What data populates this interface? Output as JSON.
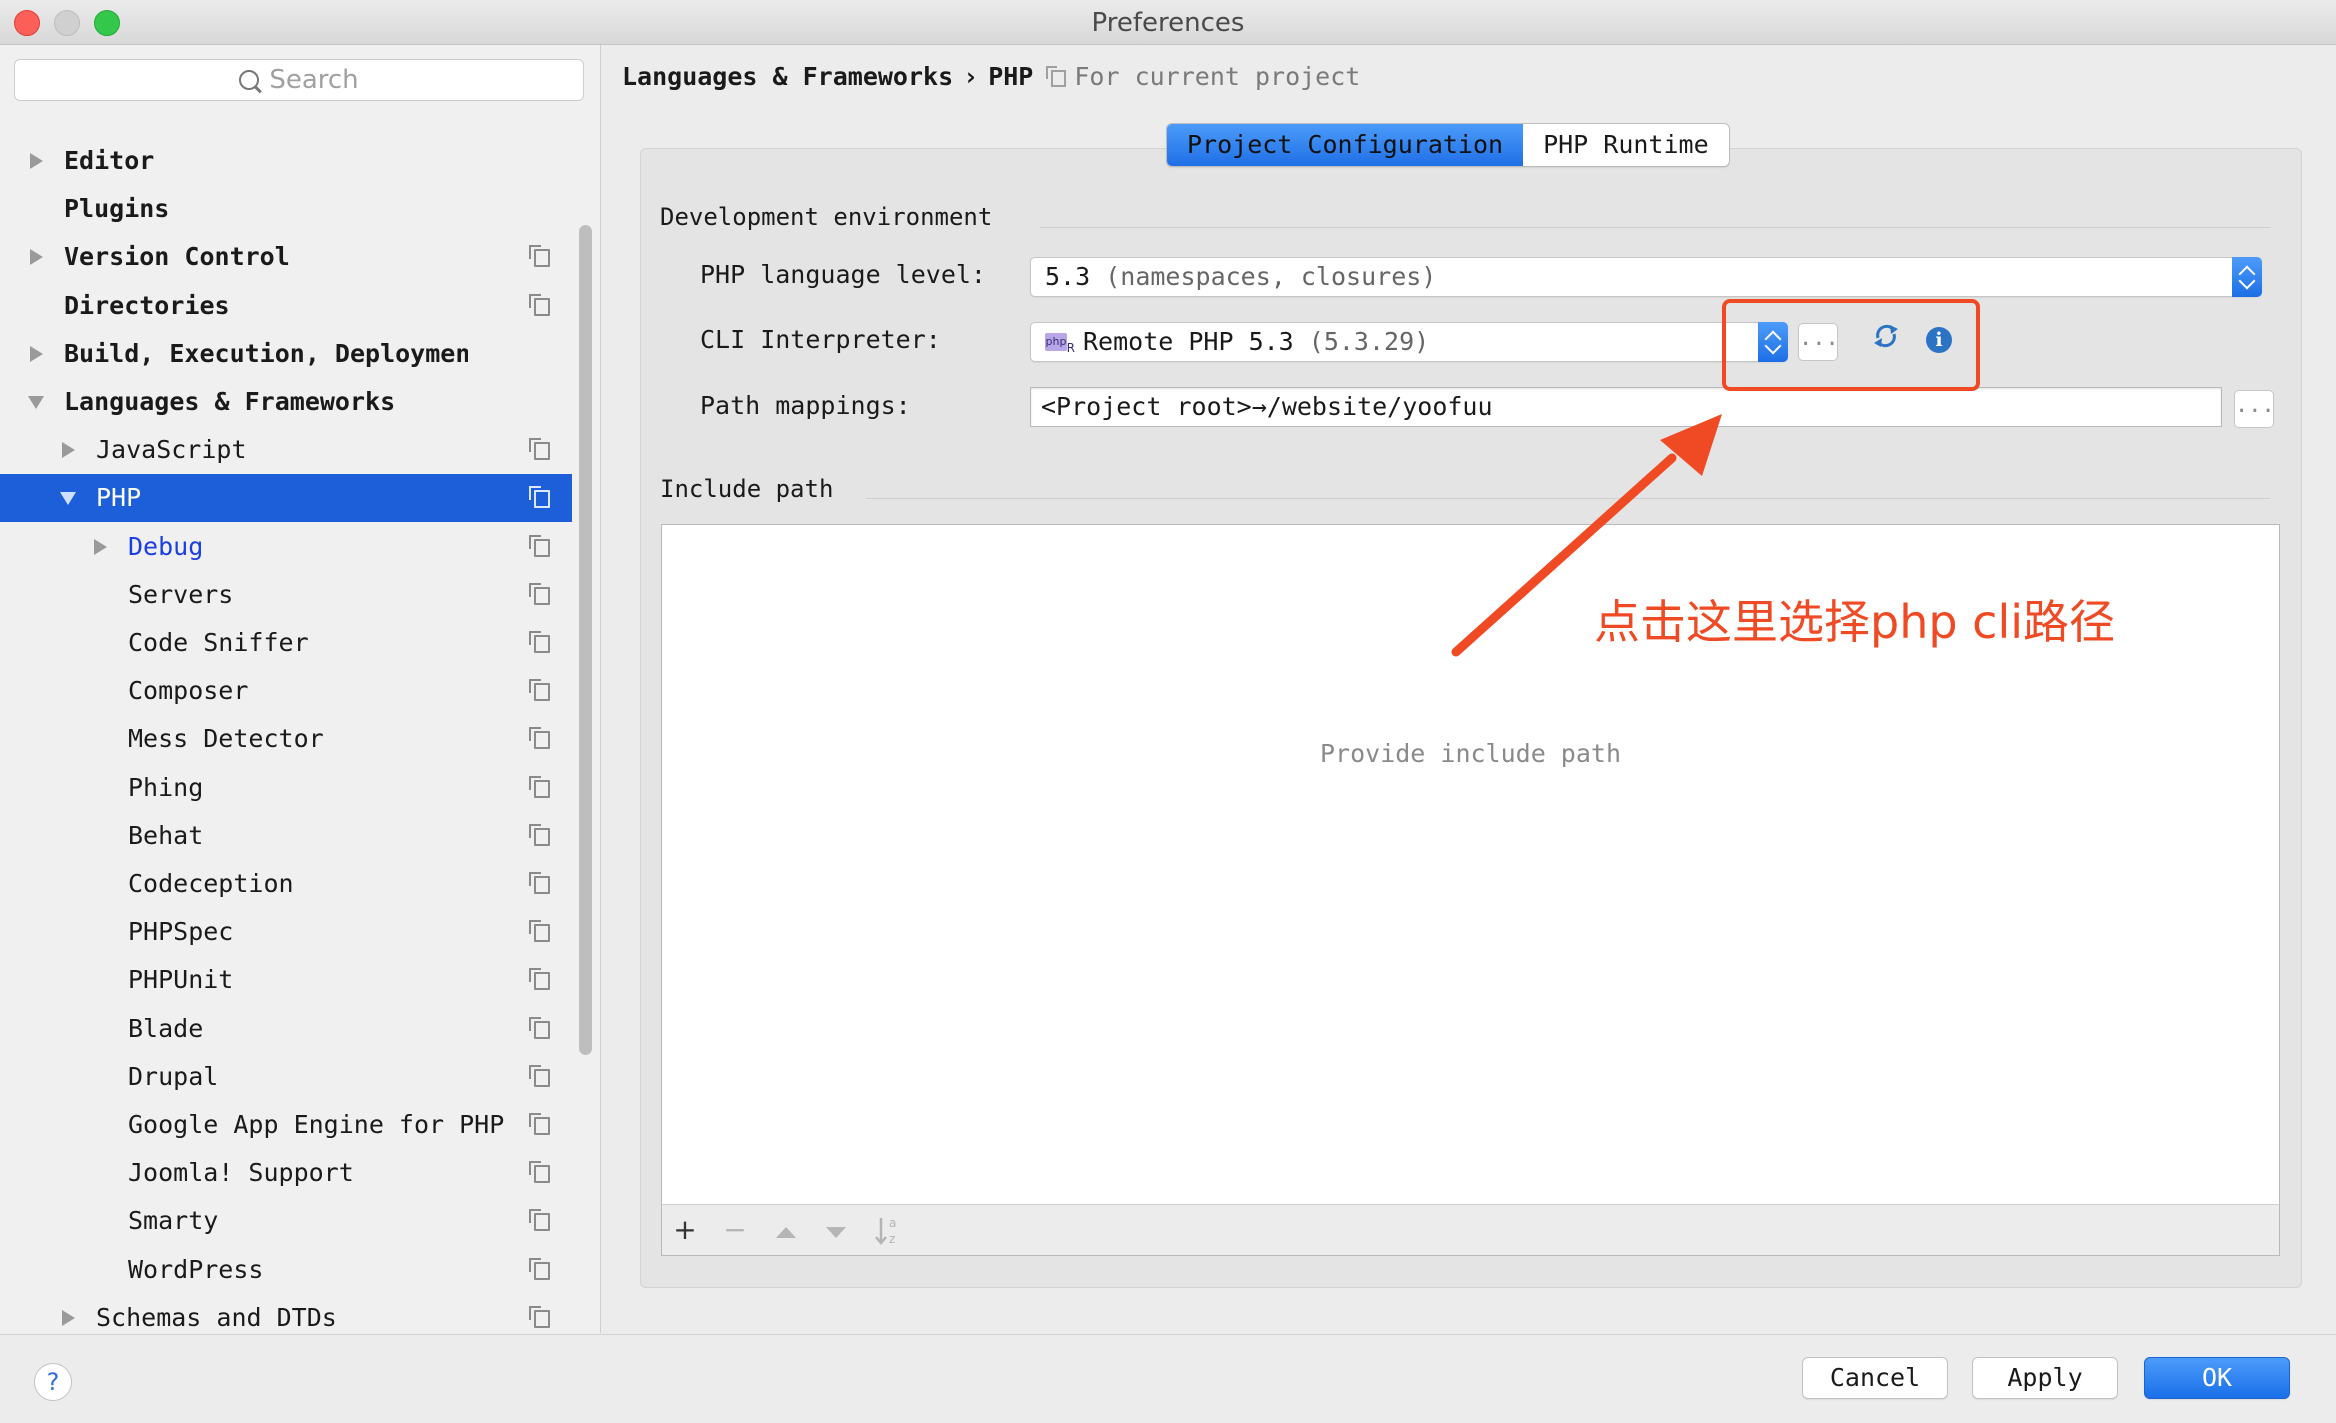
{
  "window": {
    "title": "Preferences"
  },
  "sidebar": {
    "search_placeholder": "Search",
    "items": [
      {
        "label": "Editor",
        "arrow": "right",
        "bold": true,
        "proj": false,
        "indent": 0
      },
      {
        "label": "Plugins",
        "arrow": "",
        "bold": true,
        "proj": false,
        "indent": 0
      },
      {
        "label": "Version Control",
        "arrow": "right",
        "bold": true,
        "proj": true,
        "indent": 0
      },
      {
        "label": "Directories",
        "arrow": "",
        "bold": true,
        "proj": true,
        "indent": 0
      },
      {
        "label": "Build, Execution, Deployment",
        "arrow": "right",
        "bold": true,
        "proj": false,
        "indent": 0
      },
      {
        "label": "Languages & Frameworks",
        "arrow": "down",
        "bold": true,
        "proj": false,
        "indent": 0
      },
      {
        "label": "JavaScript",
        "arrow": "right",
        "bold": false,
        "proj": true,
        "indent": 1
      },
      {
        "label": "PHP",
        "arrow": "down",
        "bold": false,
        "proj": true,
        "indent": 1,
        "selected": true
      },
      {
        "label": "Debug",
        "arrow": "right",
        "bold": false,
        "proj": true,
        "indent": 2,
        "link": true
      },
      {
        "label": "Servers",
        "arrow": "",
        "bold": false,
        "proj": true,
        "indent": 2
      },
      {
        "label": "Code Sniffer",
        "arrow": "",
        "bold": false,
        "proj": true,
        "indent": 2
      },
      {
        "label": "Composer",
        "arrow": "",
        "bold": false,
        "proj": true,
        "indent": 2
      },
      {
        "label": "Mess Detector",
        "arrow": "",
        "bold": false,
        "proj": true,
        "indent": 2
      },
      {
        "label": "Phing",
        "arrow": "",
        "bold": false,
        "proj": true,
        "indent": 2
      },
      {
        "label": "Behat",
        "arrow": "",
        "bold": false,
        "proj": true,
        "indent": 2
      },
      {
        "label": "Codeception",
        "arrow": "",
        "bold": false,
        "proj": true,
        "indent": 2
      },
      {
        "label": "PHPSpec",
        "arrow": "",
        "bold": false,
        "proj": true,
        "indent": 2
      },
      {
        "label": "PHPUnit",
        "arrow": "",
        "bold": false,
        "proj": true,
        "indent": 2
      },
      {
        "label": "Blade",
        "arrow": "",
        "bold": false,
        "proj": true,
        "indent": 2
      },
      {
        "label": "Drupal",
        "arrow": "",
        "bold": false,
        "proj": true,
        "indent": 2
      },
      {
        "label": "Google App Engine for PHP",
        "arrow": "",
        "bold": false,
        "proj": true,
        "indent": 2
      },
      {
        "label": "Joomla! Support",
        "arrow": "",
        "bold": false,
        "proj": true,
        "indent": 2
      },
      {
        "label": "Smarty",
        "arrow": "",
        "bold": false,
        "proj": true,
        "indent": 2
      },
      {
        "label": "WordPress",
        "arrow": "",
        "bold": false,
        "proj": true,
        "indent": 2
      },
      {
        "label": "Schemas and DTDs",
        "arrow": "right",
        "bold": false,
        "proj": true,
        "indent": 1
      }
    ]
  },
  "breadcrumb": {
    "parts": [
      "Languages & Frameworks",
      "PHP"
    ],
    "separator": "›",
    "scope": "For current project"
  },
  "tabs": [
    {
      "label": "Project Configuration",
      "active": true
    },
    {
      "label": "PHP Runtime",
      "active": false
    }
  ],
  "dev_env": {
    "section_title": "Development environment",
    "language_level": {
      "label": "PHP language level:",
      "value": "5.3",
      "hint": "(namespaces, closures)"
    },
    "cli": {
      "label": "CLI Interpreter:",
      "value": "Remote PHP 5.3",
      "hint": "(5.3.29)",
      "icon_text": "php"
    },
    "path_mappings": {
      "label": "Path mappings:",
      "value": "<Project root>→/website/yoofuu"
    },
    "dots": "..."
  },
  "include_path": {
    "section_title": "Include path",
    "empty_text": "Provide include path"
  },
  "annotation": {
    "text": "点击这里选择php cli路径",
    "color": "#f04a25"
  },
  "footer": {
    "help": "?",
    "cancel": "Cancel",
    "apply": "Apply",
    "ok": "OK"
  }
}
